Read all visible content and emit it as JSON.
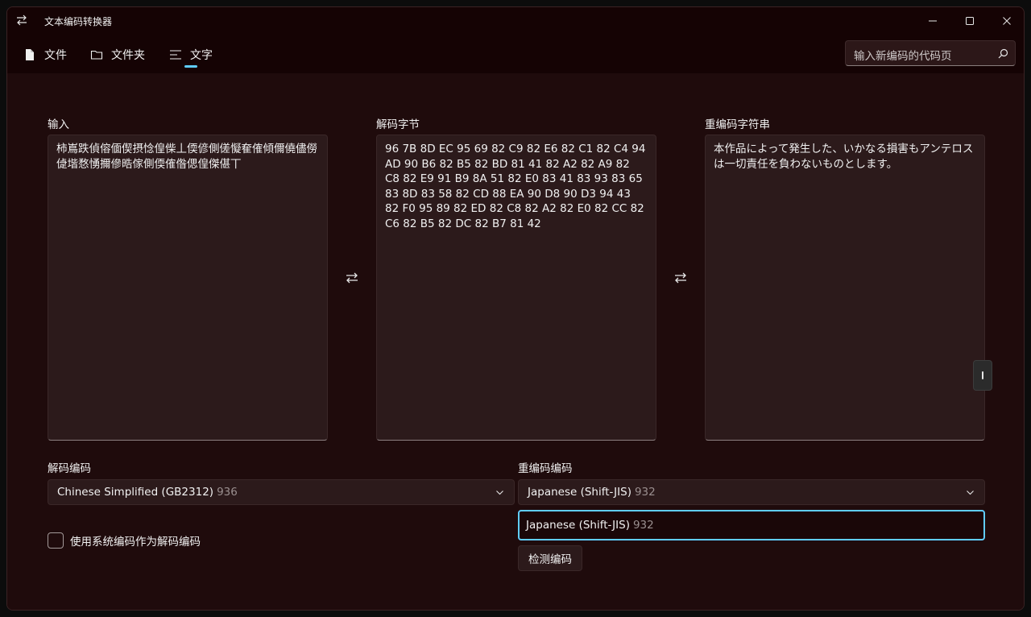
{
  "window": {
    "title": "文本编码转换器"
  },
  "nav": {
    "file_label": "文件",
    "folder_label": "文件夹",
    "text_label": "文字",
    "search_placeholder": "输入新编码的代码页"
  },
  "panels": {
    "input_label": "输入",
    "input_text": "柿嶌跌偵傛偭偰摂惗偟偨丄偄偐側傞懝奞傕傾儞僥儘僗偼堦愗愑擟傪晧傢側偄傕偺偲偟傑偡丅",
    "bytes_label": "解码字节",
    "bytes_text": "96 7B 8D EC 95 69 82 C9 82 E6 82 C1 82 C4 94 AD 90 B6 82 B5 82 BD 81 41 82 A2 82 A9 82 C8 82 E9 91 B9 8A 51 82 E0 83 41 83 93 83 65 83 8D 83 58 82 CD 88 EA 90 D8 90 D3 94 43 82 F0 95 89 82 ED 82 C8 82 A2 82 E0 82 CC 82 C6 82 B5 82 DC 82 B7 81 42",
    "output_label": "重编码字符串",
    "output_text": "本作品によって発生した、いかなる損害もアンテロスは一切責任を負わないものとします。"
  },
  "decode": {
    "label": "解码编码",
    "selected_name": "Chinese Simplified (GB2312)",
    "selected_code": "936",
    "checkbox_label": "使用系统编码作为解码编码"
  },
  "reencode": {
    "label": "重编码编码",
    "selected_name": "Japanese (Shift-JIS)",
    "selected_code": "932",
    "input_name": "Japanese (Shift-JIS)",
    "input_code": "932",
    "detect_label": "检测编码"
  },
  "colors": {
    "accent": "#60cdff",
    "background": "#1f0b0c",
    "titlebar": "#150304"
  }
}
